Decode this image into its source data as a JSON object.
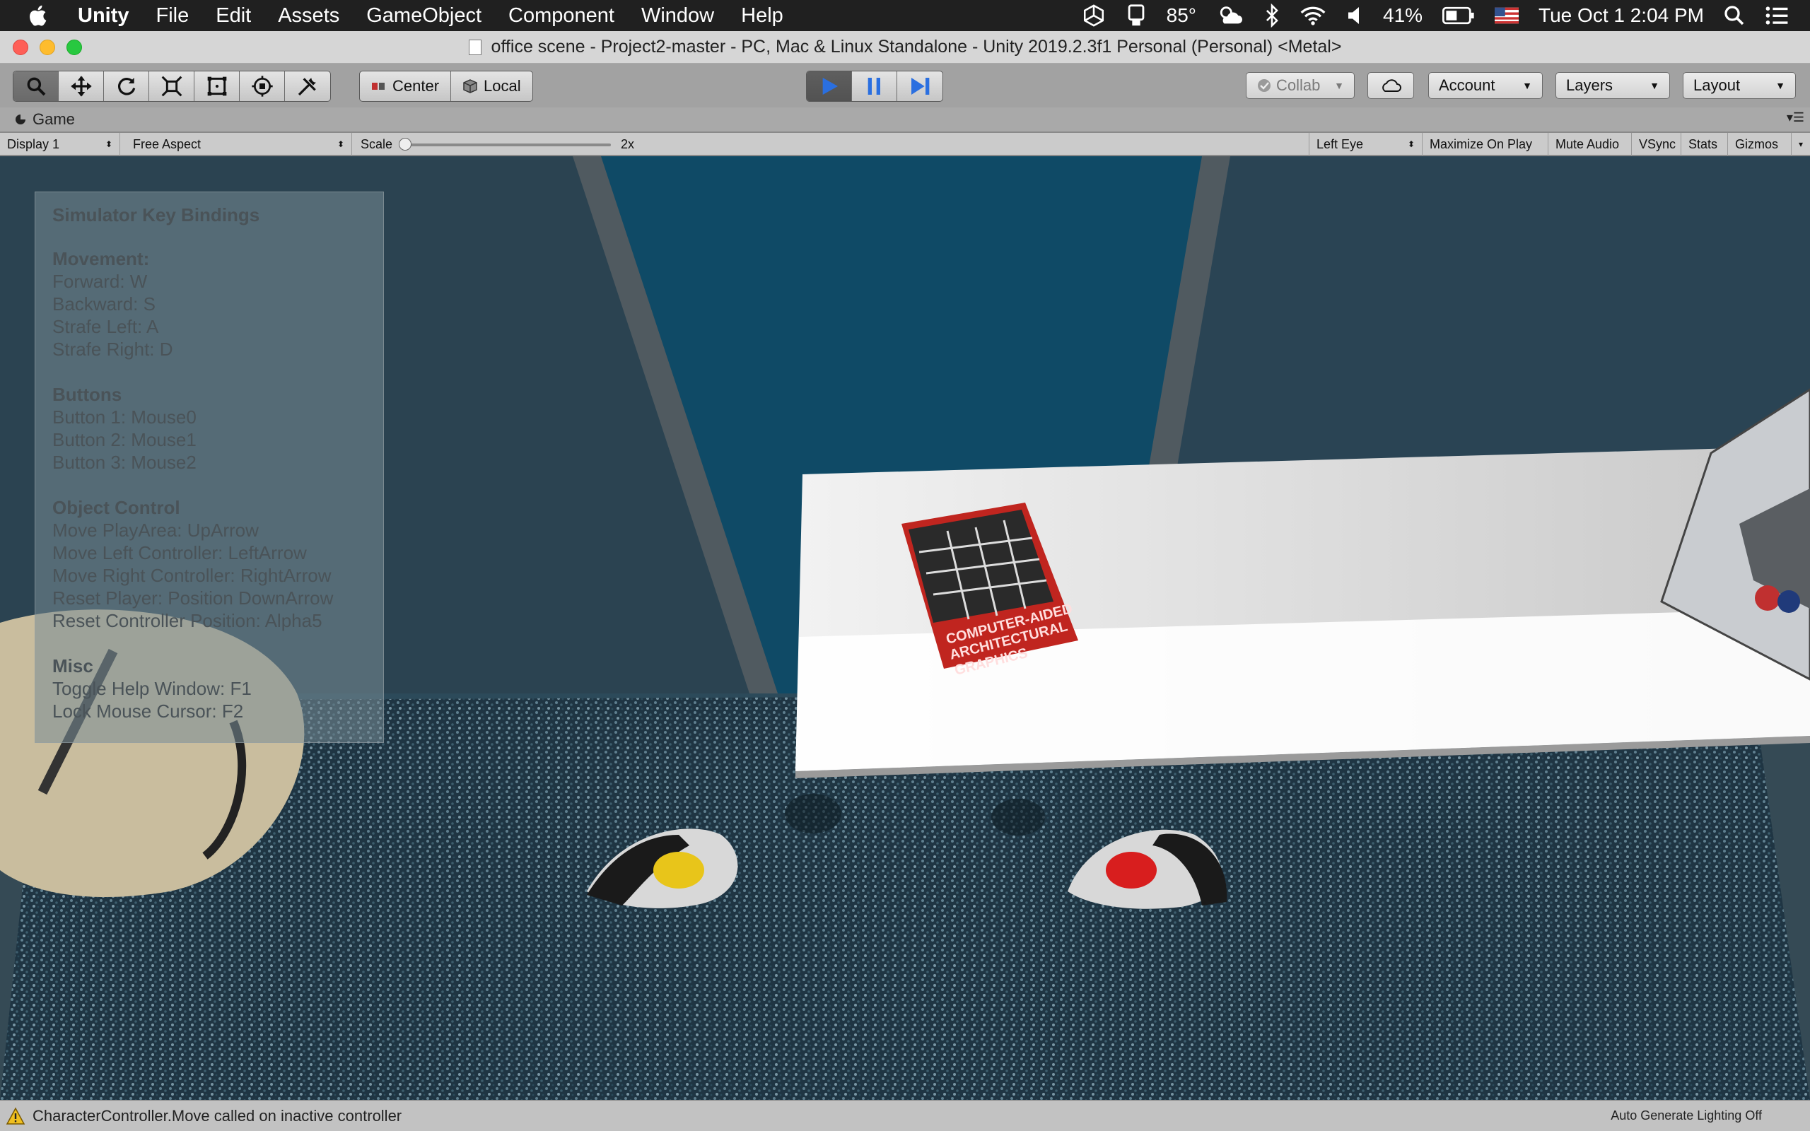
{
  "menubar": {
    "app_name": "Unity",
    "items": [
      "File",
      "Edit",
      "Assets",
      "GameObject",
      "Component",
      "Window",
      "Help"
    ],
    "temperature": "85°",
    "battery": "41%",
    "datetime": "Tue Oct 1  2:04 PM",
    "icons": [
      "apple-icon",
      "unity-icon",
      "sidecar-icon",
      "weather-icon",
      "bluetooth-icon",
      "wifi-icon",
      "volume-icon",
      "battery-icon",
      "flag-icon",
      "spotlight-search-icon",
      "notification-center-icon"
    ]
  },
  "window": {
    "title": "office scene - Project2-master - PC, Mac & Linux Standalone - Unity 2019.2.3f1 Personal (Personal) <Metal>"
  },
  "toolbar": {
    "pivot": "Center",
    "space": "Local",
    "collab": "Collab",
    "account": "Account",
    "layers": "Layers",
    "layout": "Layout",
    "tool_icons": [
      "hand-tool-icon",
      "move-tool-icon",
      "rotate-tool-icon",
      "scale-tool-icon",
      "rect-tool-icon",
      "transform-tool-icon",
      "custom-tool-icon"
    ],
    "play_state": "playing"
  },
  "game": {
    "tab_label": "Game",
    "display": "Display 1",
    "aspect": "Free Aspect",
    "scale_label": "Scale",
    "scale_value": "2x",
    "scale_slider_fraction": 0.0,
    "eye": "Left Eye",
    "maximize": "Maximize On Play",
    "mute": "Mute Audio",
    "vsync": "VSync",
    "stats": "Stats",
    "gizmos": "Gizmos"
  },
  "help": {
    "title": "Simulator Key Bindings",
    "sections": [
      {
        "heading": "Movement:",
        "lines": [
          "Forward: W",
          "Backward: S",
          "Strafe Left: A",
          "Strafe Right: D"
        ]
      },
      {
        "heading": "Buttons",
        "lines": [
          "Button 1: Mouse0",
          "Button 2: Mouse1",
          "Button 3: Mouse2"
        ]
      },
      {
        "heading": "Object Control",
        "lines": [
          "Move PlayArea: UpArrow",
          "Move Left Controller: LeftArrow",
          "Move Right Controller: RightArrow",
          "Reset Player: Position DownArrow",
          "Reset Controller Position: Alpha5"
        ]
      },
      {
        "heading": "Misc",
        "lines": [
          "Toggle Help Window: F1",
          "Lock Mouse Cursor: F2"
        ]
      }
    ]
  },
  "scene": {
    "book_title_lines": [
      "COMPUTER-AIDED",
      "ARCHITECTURAL",
      "GRAPHICS"
    ],
    "left_controller_color": "#e8c51a",
    "right_controller_color": "#d81e1e"
  },
  "status": {
    "message": "CharacterController.Move called on inactive controller",
    "lighting": "Auto Generate Lighting Off"
  },
  "colors": {
    "play_blue": "#2a6fe0",
    "wall_blue": "#0f4a66"
  }
}
